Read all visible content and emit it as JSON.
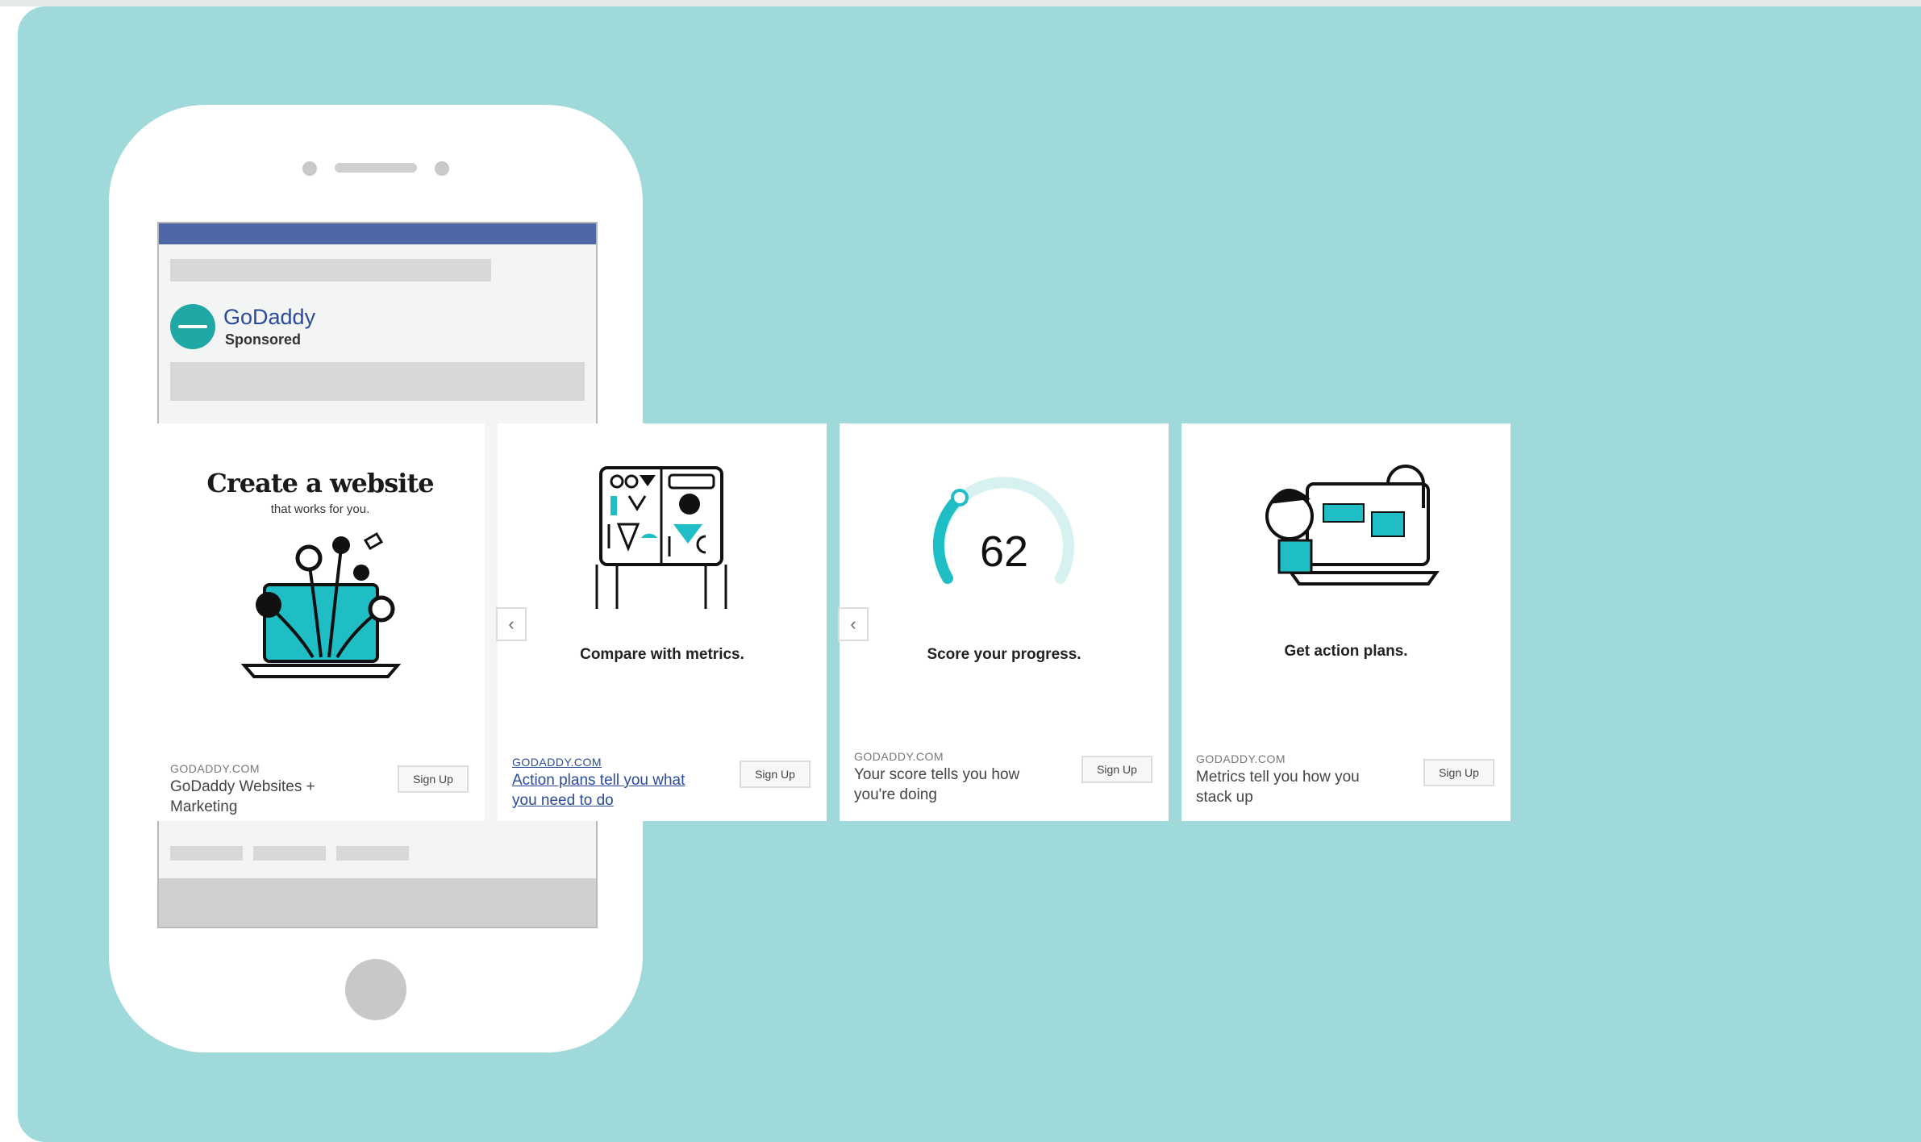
{
  "ad": {
    "brand": "GoDaddy",
    "sponsored": "Sponsored"
  },
  "colors": {
    "background": "#9fd9d9",
    "facebook_bar": "#4d67a7",
    "accent_teal": "#1fbec4",
    "link_blue": "#2a4b9a"
  },
  "cards": [
    {
      "headline": "Create a website",
      "subline": "that works for you.",
      "domain": "GODADDY.COM",
      "description": "GoDaddy Websites + Marketing",
      "button": "Sign Up",
      "icon": "laptop-flowers-illustration"
    },
    {
      "caption": "Compare with metrics.",
      "domain": "GODADDY.COM",
      "description": "Action plans tell you what you need to do",
      "button": "Sign Up",
      "icon": "tablet-shapes-illustration",
      "arrow": "‹"
    },
    {
      "caption": "Score your progress.",
      "score": "62",
      "score_fraction": 0.62,
      "domain": "GODADDY.COM",
      "description": "Your score tells you how you're doing",
      "button": "Sign Up",
      "icon": "score-gauge-illustration",
      "arrow": "‹"
    },
    {
      "caption": "Get action plans.",
      "domain": "GODADDY.COM",
      "description": "Metrics tell you how you stack up",
      "button": "Sign Up",
      "icon": "person-computer-illustration"
    }
  ]
}
